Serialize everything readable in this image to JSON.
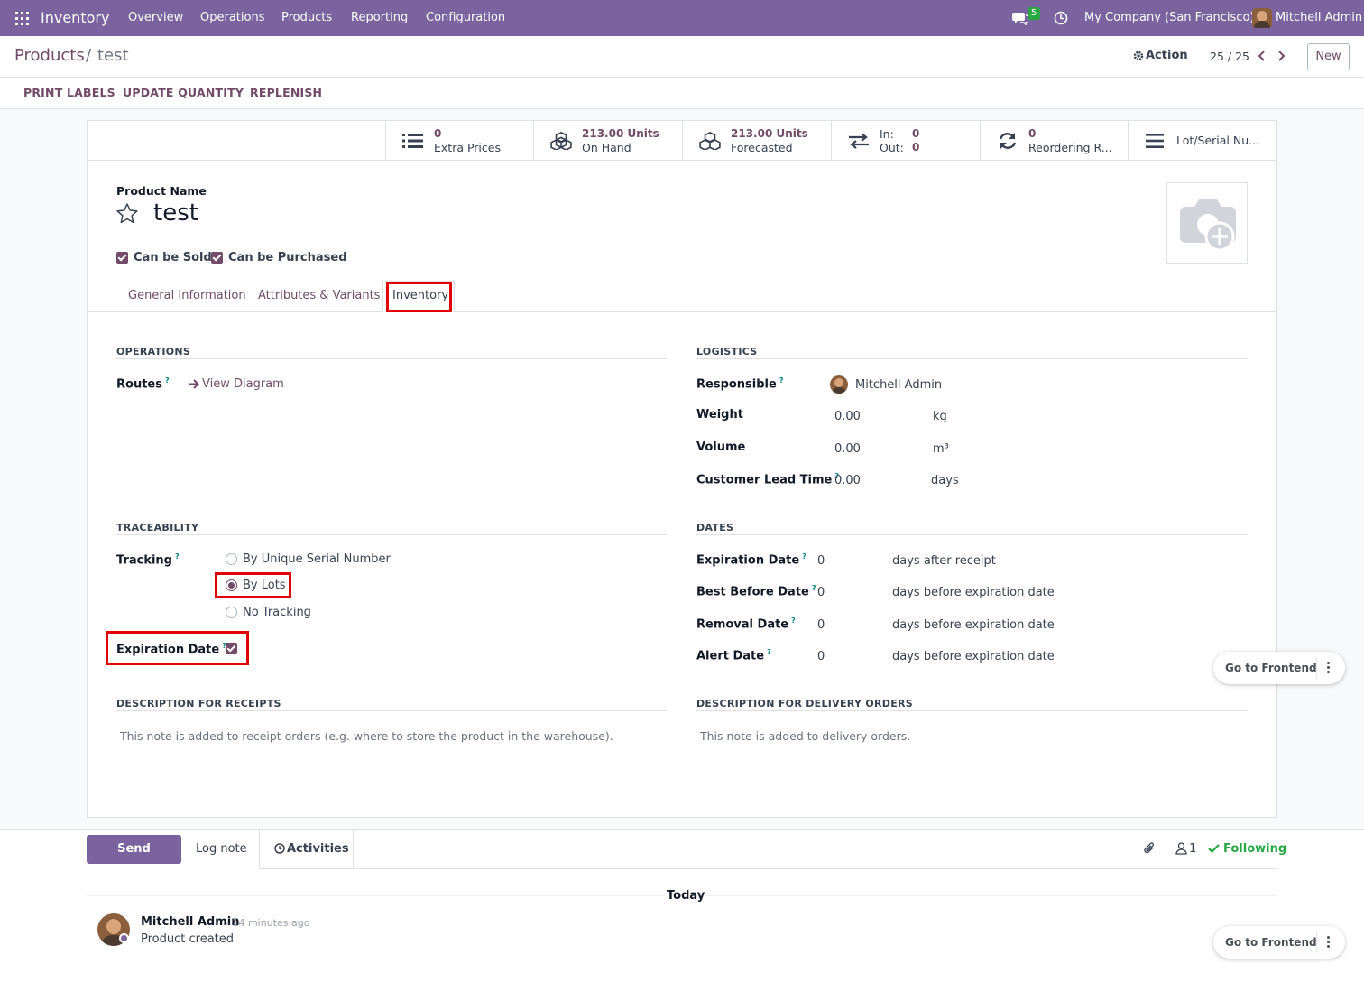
{
  "navbar": {
    "app_name": "Inventory",
    "menu": [
      "Overview",
      "Operations",
      "Products",
      "Reporting",
      "Configuration"
    ],
    "messages_badge": "5",
    "company": "My Company (San Francisco)",
    "user": "Mitchell Admin"
  },
  "breadcrumb": {
    "parent": "Products",
    "separator": "/",
    "current": "test"
  },
  "control": {
    "action_label": "Action",
    "pager": "25 / 25",
    "new_label": "New"
  },
  "header_buttons": [
    "PRINT LABELS",
    "UPDATE QUANTITY",
    "REPLENISH"
  ],
  "smart_buttons": {
    "extra_prices": {
      "value": "0",
      "label": "Extra Prices"
    },
    "on_hand": {
      "value": "213.00 Units",
      "label": "On Hand"
    },
    "forecasted": {
      "value": "213.00 Units",
      "label": "Forecasted"
    },
    "in_out": {
      "in_label": "In:",
      "in_value": "0",
      "out_label": "Out:",
      "out_value": "0"
    },
    "reordering": {
      "value": "0",
      "label": "Reordering R..."
    },
    "lot_serial": {
      "label": "Lot/Serial Nu..."
    }
  },
  "product": {
    "name_label": "Product Name",
    "name": "test",
    "can_be_sold": "Can be Sold",
    "can_be_purchased": "Can be Purchased"
  },
  "tabs": [
    "General Information",
    "Attributes & Variants",
    "Inventory"
  ],
  "operations": {
    "title": "OPERATIONS",
    "routes_label": "Routes",
    "view_diagram": "View Diagram"
  },
  "logistics": {
    "title": "LOGISTICS",
    "responsible_label": "Responsible",
    "responsible": "Mitchell Admin",
    "weight_label": "Weight",
    "weight": "0.00",
    "weight_unit": "kg",
    "volume_label": "Volume",
    "volume": "0.00",
    "volume_unit": "m³",
    "lead_label": "Customer Lead Time",
    "lead": "0.00",
    "lead_unit": "days"
  },
  "traceability": {
    "title": "TRACEABILITY",
    "tracking_label": "Tracking",
    "options": [
      "By Unique Serial Number",
      "By Lots",
      "No Tracking"
    ],
    "expiration_label": "Expiration Date"
  },
  "dates": {
    "title": "DATES",
    "expiration_label": "Expiration Date",
    "expiration": "0",
    "expiration_unit": "days after receipt",
    "best_before_label": "Best Before Date",
    "best_before": "0",
    "best_before_unit": "days before expiration date",
    "removal_label": "Removal Date",
    "removal": "0",
    "removal_unit": "days before expiration date",
    "alert_label": "Alert Date",
    "alert": "0",
    "alert_unit": "days before expiration date"
  },
  "descriptions": {
    "receipts_title": "DESCRIPTION FOR RECEIPTS",
    "receipts_placeholder": "This note is added to receipt orders (e.g. where to store the product in the warehouse).",
    "delivery_title": "DESCRIPTION FOR DELIVERY ORDERS",
    "delivery_placeholder": "This note is added to delivery orders."
  },
  "chatter": {
    "send_message": "Send message",
    "log_note": "Log note",
    "activities": "Activities",
    "followers": "1",
    "following": "Following",
    "today": "Today",
    "author": "Mitchell Admin",
    "time": "- 14 minutes ago",
    "body": "Product created"
  },
  "floating": {
    "go_frontend": "Go to Frontend"
  },
  "colors": {
    "navbar": "#7a639e",
    "brand": "#714b67",
    "highlight": "#e30000",
    "following": "#28a745"
  }
}
